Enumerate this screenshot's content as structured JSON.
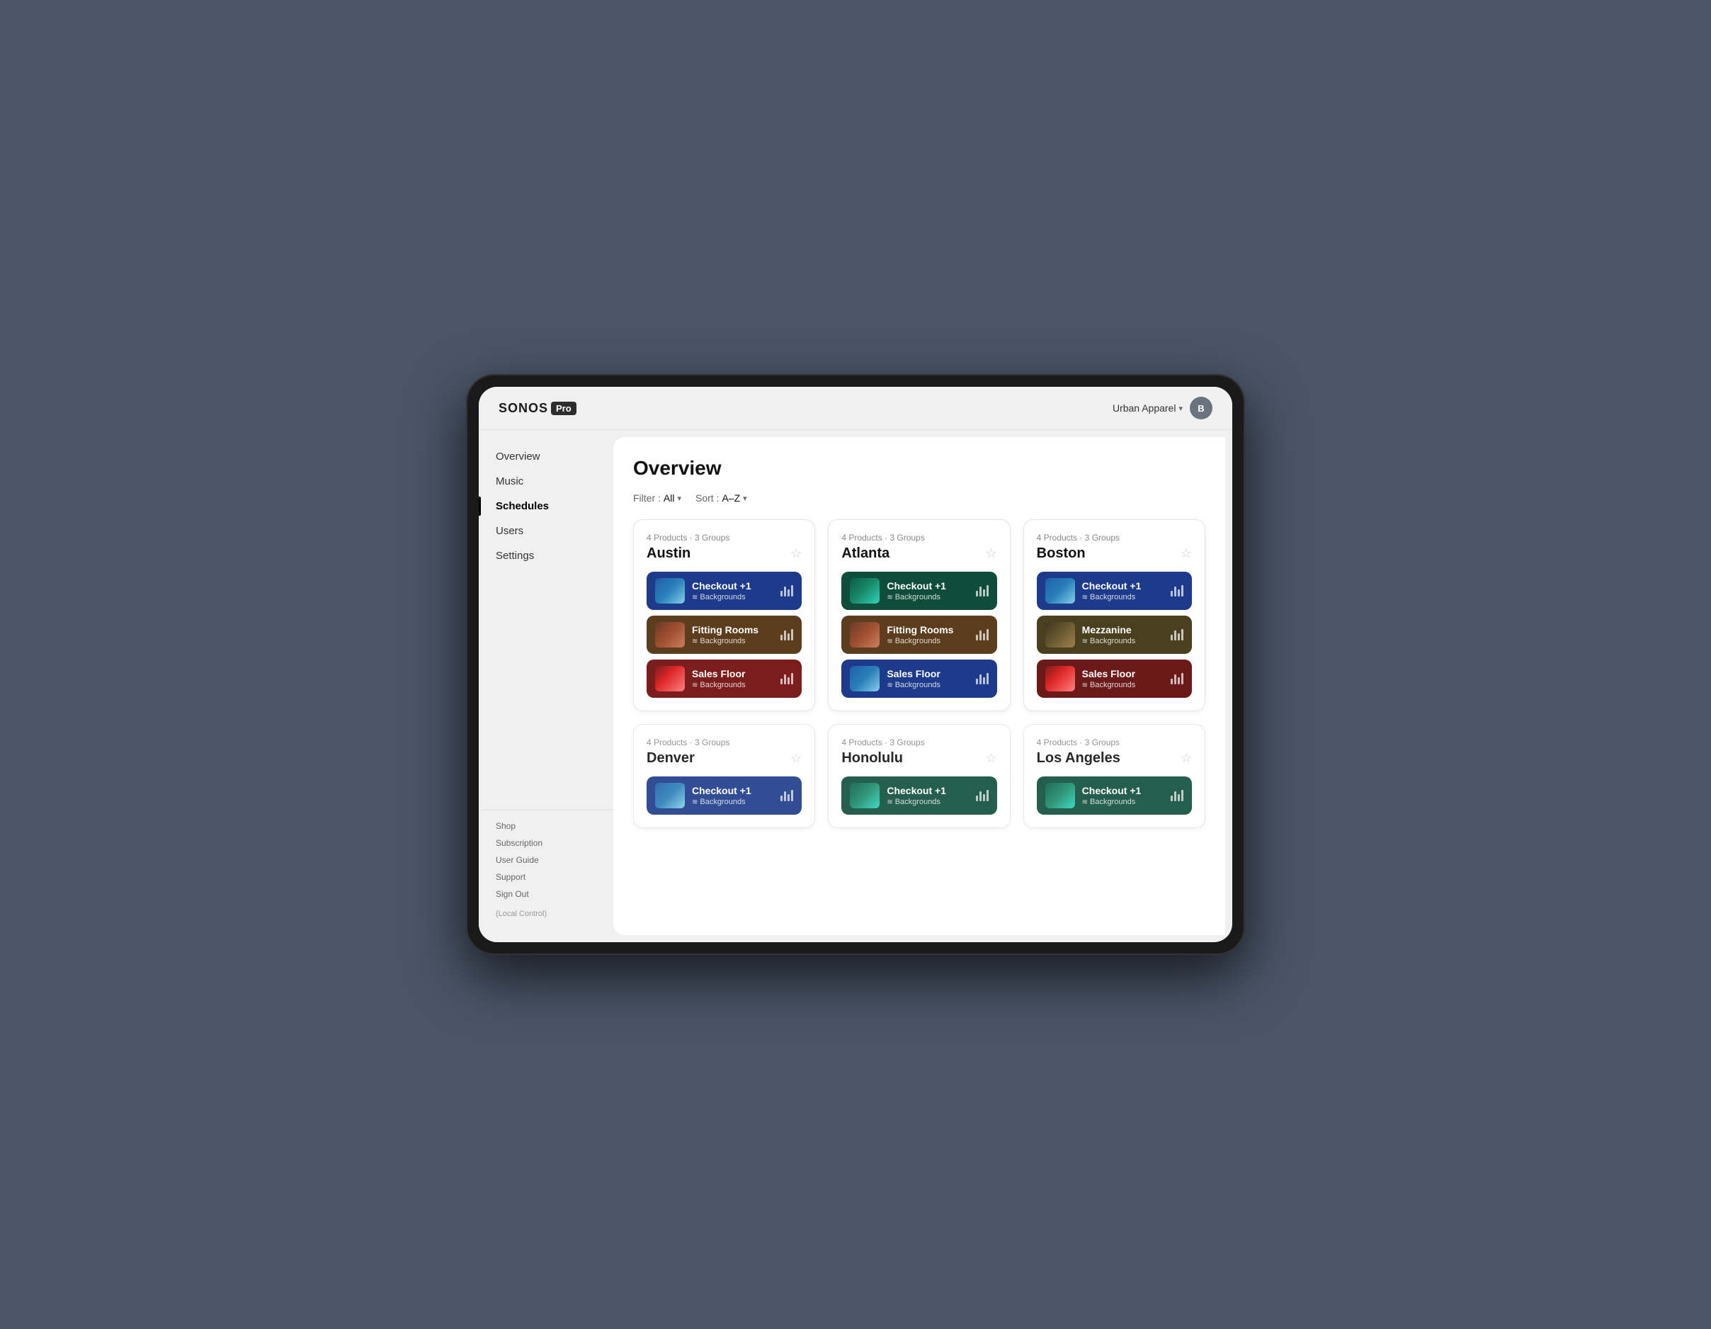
{
  "app": {
    "logo_sonos": "SONOS",
    "logo_pro": "Pro"
  },
  "header": {
    "org_name": "Urban Apparel",
    "user_initial": "B"
  },
  "sidebar": {
    "nav_items": [
      {
        "id": "overview",
        "label": "Overview",
        "active": false
      },
      {
        "id": "music",
        "label": "Music",
        "active": false
      },
      {
        "id": "schedules",
        "label": "Schedules",
        "active": true
      },
      {
        "id": "users",
        "label": "Users",
        "active": false
      },
      {
        "id": "settings",
        "label": "Settings",
        "active": false
      }
    ],
    "bottom_items": [
      {
        "id": "shop",
        "label": "Shop"
      },
      {
        "id": "subscription",
        "label": "Subscription"
      },
      {
        "id": "user-guide",
        "label": "User Guide"
      },
      {
        "id": "support",
        "label": "Support"
      },
      {
        "id": "sign-out",
        "label": "Sign Out"
      }
    ],
    "local_control": "(Local Control)"
  },
  "main": {
    "page_title": "Overview",
    "filter_label": "Filter :",
    "filter_value": "All",
    "sort_label": "Sort :",
    "sort_value": "A–Z"
  },
  "locations": [
    {
      "id": "austin",
      "name": "Austin",
      "meta": "4 Products · 3 Groups",
      "zones": [
        {
          "name": "Checkout +1",
          "sub": "Backgrounds",
          "color": "zone-blue",
          "thumb": "thumb-checkout-blue"
        },
        {
          "name": "Fitting Rooms",
          "sub": "Backgrounds",
          "color": "zone-brown",
          "thumb": "thumb-fitting"
        },
        {
          "name": "Sales Floor",
          "sub": "Backgrounds",
          "color": "zone-red",
          "thumb": "thumb-sales-red"
        }
      ]
    },
    {
      "id": "atlanta",
      "name": "Atlanta",
      "meta": "4 Products · 3 Groups",
      "zones": [
        {
          "name": "Checkout +1",
          "sub": "Backgrounds",
          "color": "zone-teal",
          "thumb": "thumb-checkout-teal"
        },
        {
          "name": "Fitting Rooms",
          "sub": "Backgrounds",
          "color": "zone-brown",
          "thumb": "thumb-fitting"
        },
        {
          "name": "Sales Floor",
          "sub": "Backgrounds",
          "color": "zone-dark-blue",
          "thumb": "thumb-checkout-blue"
        }
      ]
    },
    {
      "id": "boston",
      "name": "Boston",
      "meta": "4 Products · 3 Groups",
      "zones": [
        {
          "name": "Checkout +1",
          "sub": "Backgrounds",
          "color": "zone-blue",
          "thumb": "thumb-checkout-blue"
        },
        {
          "name": "Mezzanine",
          "sub": "Backgrounds",
          "color": "zone-olive",
          "thumb": "thumb-mezzanine"
        },
        {
          "name": "Sales Floor",
          "sub": "Backgrounds",
          "color": "zone-dark-red",
          "thumb": "thumb-sales-red"
        }
      ]
    },
    {
      "id": "denver",
      "name": "Denver",
      "meta": "4 Products · 3 Groups",
      "zones": [
        {
          "name": "Checkout +1",
          "sub": "Backgrounds",
          "color": "zone-blue",
          "thumb": "thumb-checkout-blue"
        }
      ],
      "partial": true
    },
    {
      "id": "honolulu",
      "name": "Honolulu",
      "meta": "4 Products · 3 Groups",
      "zones": [
        {
          "name": "Checkout +1",
          "sub": "Backgrounds",
          "color": "zone-teal",
          "thumb": "thumb-checkout-teal"
        }
      ],
      "partial": true
    },
    {
      "id": "los-angeles",
      "name": "Los Angeles",
      "meta": "4 Products · 3 Groups",
      "zones": [
        {
          "name": "Checkout +1",
          "sub": "Backgrounds",
          "color": "zone-teal",
          "thumb": "thumb-checkout-teal"
        }
      ],
      "partial": true
    }
  ]
}
